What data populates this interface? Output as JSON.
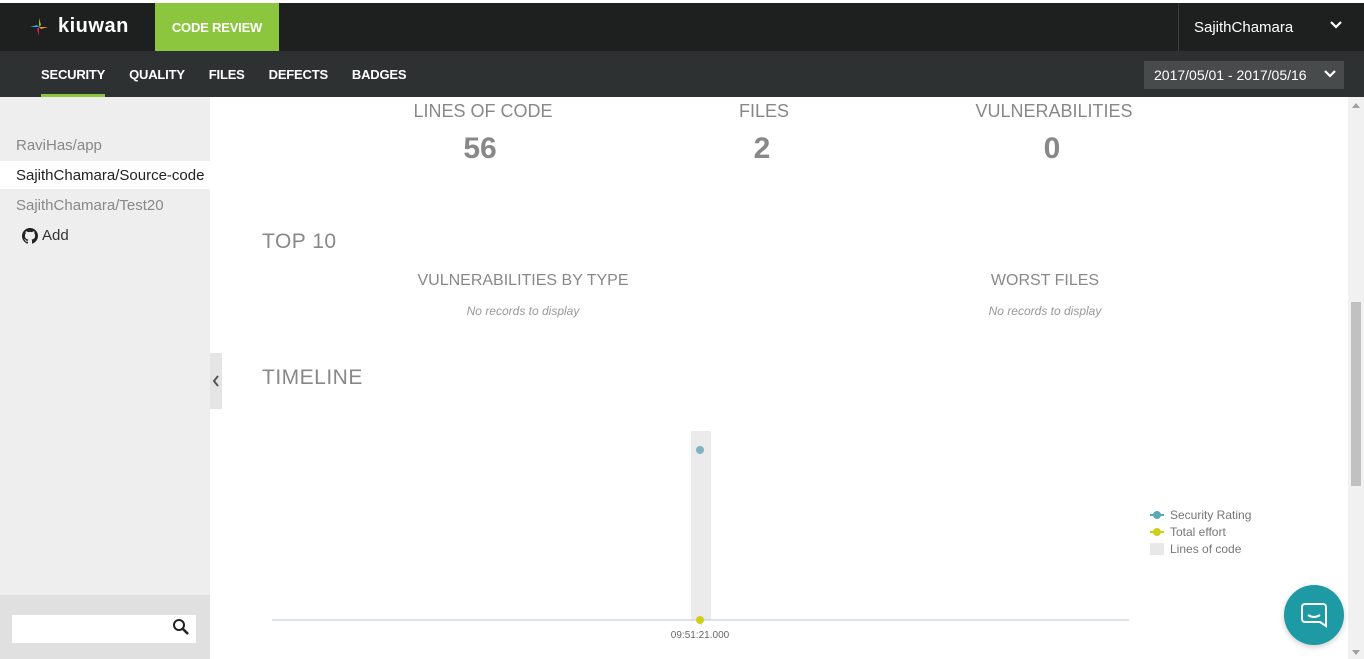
{
  "header": {
    "logo_text": "kiuwan",
    "code_review_label": "CODE REVIEW",
    "user_name": "SajithChamara"
  },
  "subnav": {
    "tabs": [
      {
        "label": "SECURITY",
        "active": true
      },
      {
        "label": "QUALITY",
        "active": false
      },
      {
        "label": "FILES",
        "active": false
      },
      {
        "label": "DEFECTS",
        "active": false
      },
      {
        "label": "BADGES",
        "active": false
      }
    ],
    "date_range": "2017/05/01 - 2017/05/16"
  },
  "sidebar": {
    "items": [
      {
        "label": "RaviHas/app",
        "active": false
      },
      {
        "label": "SajithChamara/Source-code",
        "active": true
      },
      {
        "label": "SajithChamara/Test20",
        "active": false
      }
    ],
    "add_label": "Add",
    "search_value": ""
  },
  "stats": {
    "lines_of_code_label": "LINES OF CODE",
    "lines_of_code_value": "56",
    "files_label": "FILES",
    "files_value": "2",
    "vulnerabilities_label": "VULNERABILITIES",
    "vulnerabilities_value": "0"
  },
  "top10": {
    "title": "TOP 10",
    "vuln_by_type_title": "VULNERABILITIES BY TYPE",
    "vuln_by_type_empty": "No records to display",
    "worst_files_title": "WORST FILES",
    "worst_files_empty": "No records to display"
  },
  "timeline": {
    "title": "TIMELINE",
    "x_tick": "09:51:21.000",
    "legend": [
      {
        "label": "Security Rating",
        "color": "#5aa9b8"
      },
      {
        "label": "Total effort",
        "color": "#cfcf1a"
      },
      {
        "label": "Lines of code",
        "color": "#e8e8e8"
      }
    ]
  },
  "colors": {
    "accent": "#8cc63f",
    "topbar": "#1e1f1f",
    "subnav": "#2e3132",
    "chat": "#1e9aa5"
  }
}
